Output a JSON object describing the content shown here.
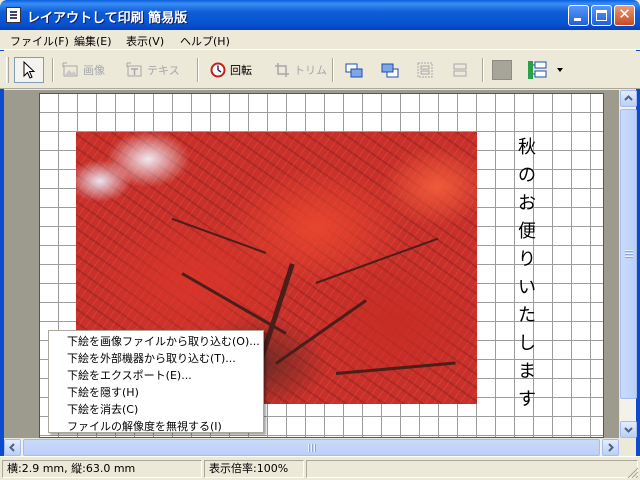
{
  "window": {
    "title": "レイアウトして印刷 簡易版",
    "controls": {
      "minimize": "",
      "maximize": "",
      "close": "✕"
    }
  },
  "menubar": {
    "items": [
      "ファイル(F)",
      "編集(E)",
      "表示(V)",
      "ヘルプ(H)"
    ]
  },
  "toolbar": {
    "image_label": "画像",
    "text_label": "テキス",
    "rotate_label": "回転",
    "trim_label": "トリム"
  },
  "canvas": {
    "vertical_text": [
      "秋",
      "の",
      "お",
      "便",
      "り",
      "い",
      "た",
      "し",
      "ま",
      "す"
    ]
  },
  "context_menu": {
    "items": [
      "下絵を画像ファイルから取り込む(O)...",
      "下絵を外部機器から取り込む(T)...",
      "下絵をエクスポート(E)...",
      "下絵を隠す(H)",
      "下絵を消去(C)",
      "ファイルの解像度を無視する(I)"
    ]
  },
  "statusbar": {
    "position": "横:2.9 mm, 縦:63.0 mm",
    "zoom": "表示倍率:100%"
  },
  "colors": {
    "titlebar": "#0A5FDB",
    "autumn_leaves": "#C9302A",
    "chrome": "#ECE9D8"
  }
}
